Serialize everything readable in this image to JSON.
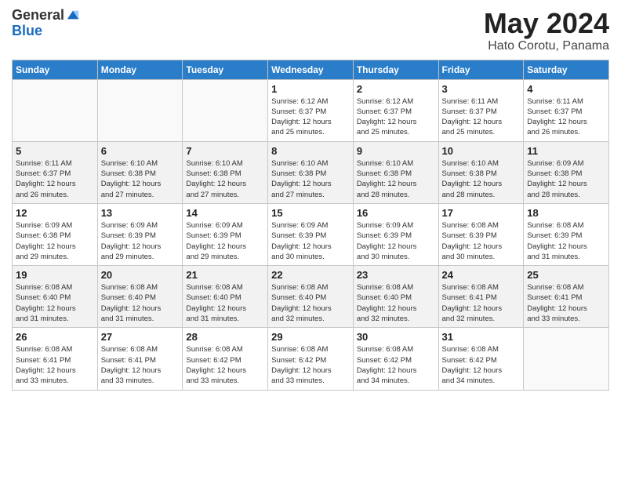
{
  "logo": {
    "general": "General",
    "blue": "Blue"
  },
  "header": {
    "month": "May 2024",
    "location": "Hato Corotu, Panama"
  },
  "weekdays": [
    "Sunday",
    "Monday",
    "Tuesday",
    "Wednesday",
    "Thursday",
    "Friday",
    "Saturday"
  ],
  "weeks": [
    [
      {
        "day": "",
        "info": ""
      },
      {
        "day": "",
        "info": ""
      },
      {
        "day": "",
        "info": ""
      },
      {
        "day": "1",
        "info": "Sunrise: 6:12 AM\nSunset: 6:37 PM\nDaylight: 12 hours\nand 25 minutes."
      },
      {
        "day": "2",
        "info": "Sunrise: 6:12 AM\nSunset: 6:37 PM\nDaylight: 12 hours\nand 25 minutes."
      },
      {
        "day": "3",
        "info": "Sunrise: 6:11 AM\nSunset: 6:37 PM\nDaylight: 12 hours\nand 25 minutes."
      },
      {
        "day": "4",
        "info": "Sunrise: 6:11 AM\nSunset: 6:37 PM\nDaylight: 12 hours\nand 26 minutes."
      }
    ],
    [
      {
        "day": "5",
        "info": "Sunrise: 6:11 AM\nSunset: 6:37 PM\nDaylight: 12 hours\nand 26 minutes."
      },
      {
        "day": "6",
        "info": "Sunrise: 6:10 AM\nSunset: 6:38 PM\nDaylight: 12 hours\nand 27 minutes."
      },
      {
        "day": "7",
        "info": "Sunrise: 6:10 AM\nSunset: 6:38 PM\nDaylight: 12 hours\nand 27 minutes."
      },
      {
        "day": "8",
        "info": "Sunrise: 6:10 AM\nSunset: 6:38 PM\nDaylight: 12 hours\nand 27 minutes."
      },
      {
        "day": "9",
        "info": "Sunrise: 6:10 AM\nSunset: 6:38 PM\nDaylight: 12 hours\nand 28 minutes."
      },
      {
        "day": "10",
        "info": "Sunrise: 6:10 AM\nSunset: 6:38 PM\nDaylight: 12 hours\nand 28 minutes."
      },
      {
        "day": "11",
        "info": "Sunrise: 6:09 AM\nSunset: 6:38 PM\nDaylight: 12 hours\nand 28 minutes."
      }
    ],
    [
      {
        "day": "12",
        "info": "Sunrise: 6:09 AM\nSunset: 6:38 PM\nDaylight: 12 hours\nand 29 minutes."
      },
      {
        "day": "13",
        "info": "Sunrise: 6:09 AM\nSunset: 6:39 PM\nDaylight: 12 hours\nand 29 minutes."
      },
      {
        "day": "14",
        "info": "Sunrise: 6:09 AM\nSunset: 6:39 PM\nDaylight: 12 hours\nand 29 minutes."
      },
      {
        "day": "15",
        "info": "Sunrise: 6:09 AM\nSunset: 6:39 PM\nDaylight: 12 hours\nand 30 minutes."
      },
      {
        "day": "16",
        "info": "Sunrise: 6:09 AM\nSunset: 6:39 PM\nDaylight: 12 hours\nand 30 minutes."
      },
      {
        "day": "17",
        "info": "Sunrise: 6:08 AM\nSunset: 6:39 PM\nDaylight: 12 hours\nand 30 minutes."
      },
      {
        "day": "18",
        "info": "Sunrise: 6:08 AM\nSunset: 6:39 PM\nDaylight: 12 hours\nand 31 minutes."
      }
    ],
    [
      {
        "day": "19",
        "info": "Sunrise: 6:08 AM\nSunset: 6:40 PM\nDaylight: 12 hours\nand 31 minutes."
      },
      {
        "day": "20",
        "info": "Sunrise: 6:08 AM\nSunset: 6:40 PM\nDaylight: 12 hours\nand 31 minutes."
      },
      {
        "day": "21",
        "info": "Sunrise: 6:08 AM\nSunset: 6:40 PM\nDaylight: 12 hours\nand 31 minutes."
      },
      {
        "day": "22",
        "info": "Sunrise: 6:08 AM\nSunset: 6:40 PM\nDaylight: 12 hours\nand 32 minutes."
      },
      {
        "day": "23",
        "info": "Sunrise: 6:08 AM\nSunset: 6:40 PM\nDaylight: 12 hours\nand 32 minutes."
      },
      {
        "day": "24",
        "info": "Sunrise: 6:08 AM\nSunset: 6:41 PM\nDaylight: 12 hours\nand 32 minutes."
      },
      {
        "day": "25",
        "info": "Sunrise: 6:08 AM\nSunset: 6:41 PM\nDaylight: 12 hours\nand 33 minutes."
      }
    ],
    [
      {
        "day": "26",
        "info": "Sunrise: 6:08 AM\nSunset: 6:41 PM\nDaylight: 12 hours\nand 33 minutes."
      },
      {
        "day": "27",
        "info": "Sunrise: 6:08 AM\nSunset: 6:41 PM\nDaylight: 12 hours\nand 33 minutes."
      },
      {
        "day": "28",
        "info": "Sunrise: 6:08 AM\nSunset: 6:42 PM\nDaylight: 12 hours\nand 33 minutes."
      },
      {
        "day": "29",
        "info": "Sunrise: 6:08 AM\nSunset: 6:42 PM\nDaylight: 12 hours\nand 33 minutes."
      },
      {
        "day": "30",
        "info": "Sunrise: 6:08 AM\nSunset: 6:42 PM\nDaylight: 12 hours\nand 34 minutes."
      },
      {
        "day": "31",
        "info": "Sunrise: 6:08 AM\nSunset: 6:42 PM\nDaylight: 12 hours\nand 34 minutes."
      },
      {
        "day": "",
        "info": ""
      }
    ]
  ]
}
